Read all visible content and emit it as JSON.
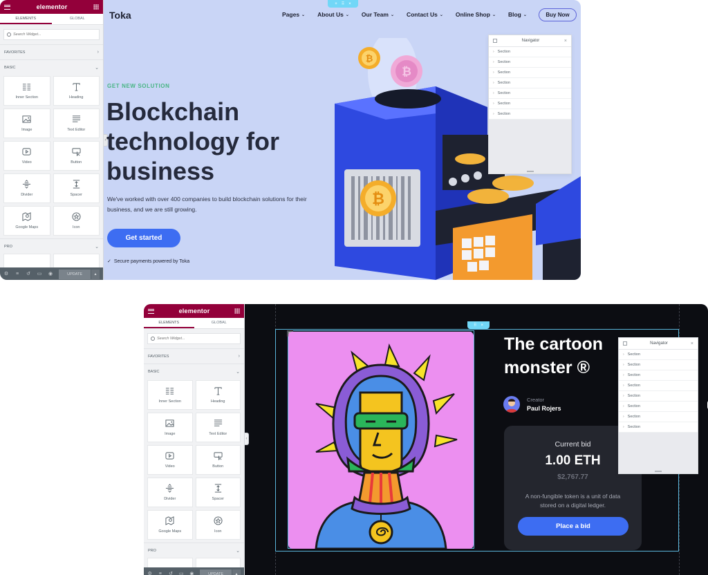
{
  "editor": {
    "brand": "elementor",
    "tabs": [
      "ELEMENTS",
      "GLOBAL"
    ],
    "search_placeholder": "Search Widget...",
    "categories": {
      "favorites": "FAVORITES",
      "basic": "BASIC",
      "pro": "PRO"
    },
    "widgets": [
      {
        "label": "Inner Section",
        "icon": "inner-section-icon"
      },
      {
        "label": "Heading",
        "icon": "heading-icon"
      },
      {
        "label": "Image",
        "icon": "image-icon"
      },
      {
        "label": "Text Editor",
        "icon": "text-editor-icon"
      },
      {
        "label": "Video",
        "icon": "video-icon"
      },
      {
        "label": "Button",
        "icon": "button-icon"
      },
      {
        "label": "Divider",
        "icon": "divider-icon"
      },
      {
        "label": "Spacer",
        "icon": "spacer-icon"
      },
      {
        "label": "Google Maps",
        "icon": "google-maps-icon"
      },
      {
        "label": "Icon",
        "icon": "star-icon"
      }
    ],
    "update_label": "UPDATE",
    "colors": {
      "brand": "#93003a",
      "panel_bg": "#f1f2f4",
      "footer": "#556068",
      "handle": "#71d7f7"
    }
  },
  "navigator": {
    "title": "Navigator",
    "rows": [
      "Section",
      "Section",
      "Section",
      "Section",
      "Section",
      "Section",
      "Section",
      "Section"
    ]
  },
  "site1": {
    "logo": "Toka",
    "menu": [
      {
        "label": "Pages",
        "has_dropdown": true
      },
      {
        "label": "About Us",
        "has_dropdown": true
      },
      {
        "label": "Our Team",
        "has_dropdown": true
      },
      {
        "label": "Contact Us",
        "has_dropdown": true
      },
      {
        "label": "Online Shop",
        "has_dropdown": true
      },
      {
        "label": "Blog",
        "has_dropdown": true
      }
    ],
    "buy_button": "Buy Now",
    "eyebrow": "GET NEW SOLUTION",
    "headline": "Blockchain technology for business",
    "lead": "We've worked with over 400 companies to build blockchain solutions for their business, and we are still growing.",
    "cta": "Get started",
    "secure_note": "Secure payments powered by Toka",
    "colors": {
      "bg": "#c9d5f6",
      "accent": "#3d6df2",
      "eyebrow": "#48b584"
    }
  },
  "site2": {
    "title": "The cartoon monster ®",
    "creator_label": "Creator",
    "creator_name": "Paul Rojers",
    "bid_label": "Current bid",
    "bid_value": "1.00 ETH",
    "bid_usd": "$2,767.77",
    "bid_desc": "A non-fungible token is a unit of data stored on a digital ledger.",
    "bid_button": "Place a bid",
    "colors": {
      "bg": "#0c0d12",
      "card": "#24262e",
      "art_bg": "#ec8ff0",
      "accent": "#3d6df2"
    }
  }
}
